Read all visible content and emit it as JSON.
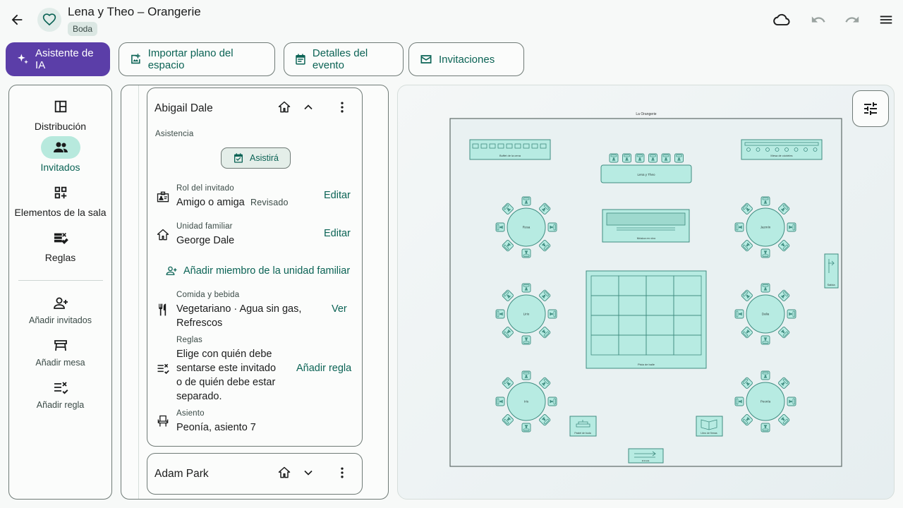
{
  "header": {
    "title": "Lena y Theo – Orangerie",
    "tag": "Boda"
  },
  "toolbar": {
    "ai_label": "Asistente de IA",
    "import_label": "Importar plano del espacio",
    "details_label": "Detalles del evento",
    "invites_label": "Invitaciones"
  },
  "nav": {
    "items": [
      {
        "label": "Distribución",
        "icon": "layout-icon"
      },
      {
        "label": "Invitados",
        "icon": "people-icon",
        "active": true
      },
      {
        "label": "Elementos de la sala",
        "icon": "widgets-icon"
      },
      {
        "label": "Reglas",
        "icon": "rules-icon"
      }
    ],
    "actions": [
      {
        "label": "Añadir invitados",
        "icon": "person-add-icon"
      },
      {
        "label": "Añadir mesa",
        "icon": "table-icon"
      },
      {
        "label": "Añadir regla",
        "icon": "rule-add-icon"
      }
    ]
  },
  "guests": [
    {
      "name": "Abigail Dale",
      "expanded": true,
      "attendance_label": "Asistencia",
      "attendance_value": "Asistirá",
      "role_label": "Rol del invitado",
      "role_value": "Amigo o amiga",
      "role_status": "Revisado",
      "role_action": "Editar",
      "household_label": "Unidad familiar",
      "household_value": "George Dale",
      "household_action": "Editar",
      "add_household": "Añadir miembro de la unidad familiar",
      "food_label": "Comida y bebida",
      "food_value_1": "Vegetariano · Agua sin gas,",
      "food_value_2": "Refrescos",
      "food_action": "Ver",
      "rules_label": "Reglas",
      "rules_text_1": "Elige con quién debe",
      "rules_text_2": "sentarse este invitado",
      "rules_text_3": "o de quién debe estar",
      "rules_text_4": "separado.",
      "rules_action": "Añadir regla",
      "seat_label": "Asiento",
      "seat_value": "Peonía, asiento 7"
    },
    {
      "name": "Adam Park",
      "expanded": false
    }
  ],
  "floorplan": {
    "venue": "La Orangerie",
    "head_table": "Lena y Theo",
    "buffet": "Buffet de la cena",
    "cocktail": "Mesa de cócteles",
    "dj": "Música en vivo",
    "dance": "Pista de baile",
    "cake": "Pastel de boda",
    "guestbook": "Libro de firmas",
    "exit": "Salida",
    "entrance": "Entrada",
    "tables": [
      "Rosa",
      "Jazmín",
      "Lirio",
      "Dalia",
      "Iris",
      "Peonía"
    ],
    "colors": {
      "accent": "#0b6355",
      "fill": "#b7ebe2",
      "stroke": "#3f8c80"
    }
  }
}
